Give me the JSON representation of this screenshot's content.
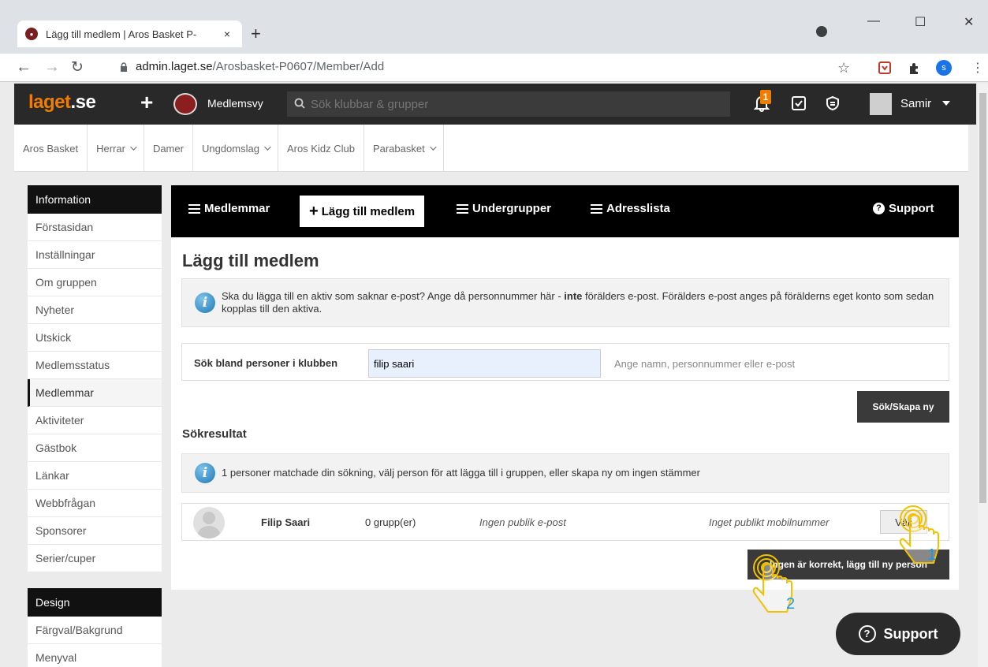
{
  "browser": {
    "tab_title": "Lägg till medlem | Aros Basket P-",
    "tab_close": "×",
    "new_tab": "+",
    "url_host": "admin.laget.se",
    "url_path": "/Arosbasket-P0607/Member/Add",
    "profile_letter": "s",
    "minimize": "—",
    "maximize": "☐",
    "close": "✕"
  },
  "topbar": {
    "logo_main": "laget",
    "logo_suffix": ".se",
    "view_label": "Medlemsvy",
    "search_placeholder": "Sök klubbar & grupper",
    "notification_count": "1",
    "user_name": "Samir"
  },
  "club_menu": [
    {
      "label": "Aros Basket",
      "dropdown": false
    },
    {
      "label": "Herrar",
      "dropdown": true
    },
    {
      "label": "Damer",
      "dropdown": false
    },
    {
      "label": "Ungdomslag",
      "dropdown": true
    },
    {
      "label": "Aros Kidz Club",
      "dropdown": false
    },
    {
      "label": "Parabasket",
      "dropdown": true
    }
  ],
  "sidebar": {
    "info_heading": "Information",
    "info_items": [
      "Förstasidan",
      "Inställningar",
      "Om gruppen",
      "Nyheter",
      "Utskick",
      "Medlemsstatus",
      "Medlemmar",
      "Aktiviteter",
      "Gästbok",
      "Länkar",
      "Webbfrågan",
      "Sponsorer",
      "Serier/cuper"
    ],
    "active_item": "Medlemmar",
    "design_heading": "Design",
    "design_items": [
      "Färgval/Bakgrund",
      "Menyval"
    ]
  },
  "subnav": {
    "members": "Medlemmar",
    "add_member": "Lägg till medlem",
    "subgroups": "Undergrupper",
    "address_list": "Adresslista",
    "support": "Support"
  },
  "page": {
    "title": "Lägg till medlem",
    "info_text_pre": "Ska du lägga till en aktiv som saknar e-post? Ange då personnummer här - ",
    "info_text_bold": "inte",
    "info_text_post": " förälders e-post. Förälders e-post anges på förälderns eget konto som sedan kopplas till den aktiva.",
    "search_label": "Sök bland personer i klubben",
    "search_value": "filip saari",
    "search_help": "Ange namn, personnummer eller e-post",
    "search_button": "Sök/Skapa ny",
    "results_title": "Sökresultat",
    "results_info": "1 personer matchade din sökning, välj person för att lägga till i gruppen, eller skapa ny om ingen stämmer",
    "result": {
      "name": "Filip Saari",
      "groups": "0 grupp(er)",
      "email": "Ingen publik e-post",
      "mobile": "Inget publikt mobilnummer",
      "select_button": "Välj"
    },
    "create_new_button": "Ingen är korrekt, lägg till ny person"
  },
  "support_float": "Support",
  "annotations": {
    "step1": "1",
    "step2": "2"
  },
  "colors": {
    "brand_orange": "#f07d00",
    "topbar": "#292929",
    "info_blue": "#1f78b4",
    "annotation": "#1e9be0"
  }
}
